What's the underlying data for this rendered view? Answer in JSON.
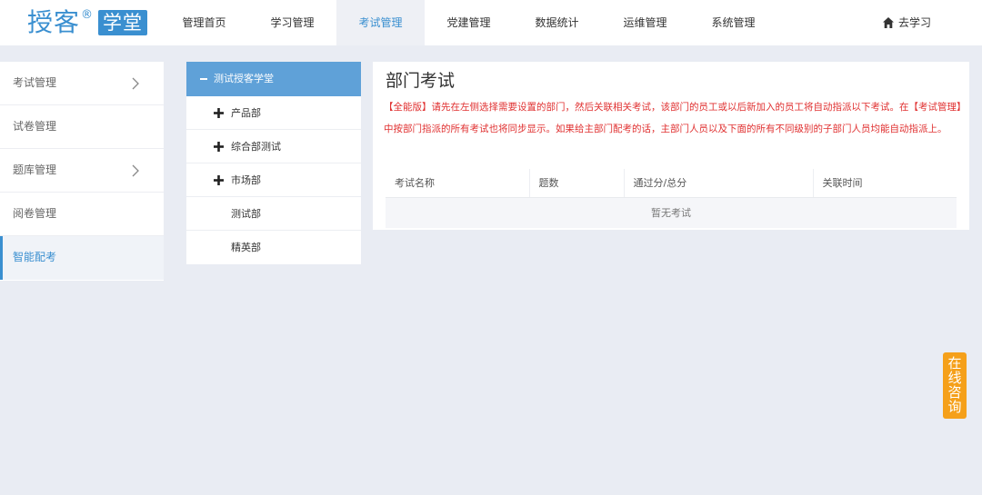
{
  "logo": {
    "main": "授客",
    "reg": "®",
    "box": "学堂"
  },
  "nav": {
    "items": [
      "管理首页",
      "学习管理",
      "考试管理",
      "党建管理",
      "数据统计",
      "运维管理",
      "系统管理"
    ],
    "active_index": 2,
    "go_study": "去学习"
  },
  "sidebar": {
    "items": [
      {
        "label": "考试管理",
        "has_chevron": true
      },
      {
        "label": "试卷管理",
        "has_chevron": false
      },
      {
        "label": "题库管理",
        "has_chevron": true
      },
      {
        "label": "阅卷管理",
        "has_chevron": false
      },
      {
        "label": "智能配考",
        "has_chevron": false
      }
    ],
    "active_index": 4
  },
  "tree": {
    "root": "测试授客学堂",
    "children": [
      {
        "label": "产品部",
        "expandable": true
      },
      {
        "label": "综合部测试",
        "expandable": true
      },
      {
        "label": "市场部",
        "expandable": true
      },
      {
        "label": "测试部",
        "expandable": false
      },
      {
        "label": "精英部",
        "expandable": false
      }
    ]
  },
  "panel": {
    "title": "部门考试",
    "notice": "【全能版】请先在左侧选择需要设置的部门，然后关联相关考试，该部门的员工或以后新加入的员工将自动指派以下考试。在【考试管理】中按部门指派的所有考试也将同步显示。如果给主部门配考的话，主部门人员以及下面的所有不同级别的子部门人员均能自动指派上。",
    "columns": [
      "考试名称",
      "题数",
      "通过分/总分",
      "关联时间"
    ],
    "empty_text": "暂无考试"
  },
  "consult": {
    "label": "在线咨询"
  },
  "colors": {
    "accent": "#3a8fd0",
    "tree_active": "#5fa1d8",
    "notice": "#e03131",
    "consult": "#f5a01a"
  },
  "icons": {
    "home": "home-icon",
    "chevron": "chevron-right-icon",
    "plus": "plus-icon",
    "minus": "minus-icon"
  }
}
